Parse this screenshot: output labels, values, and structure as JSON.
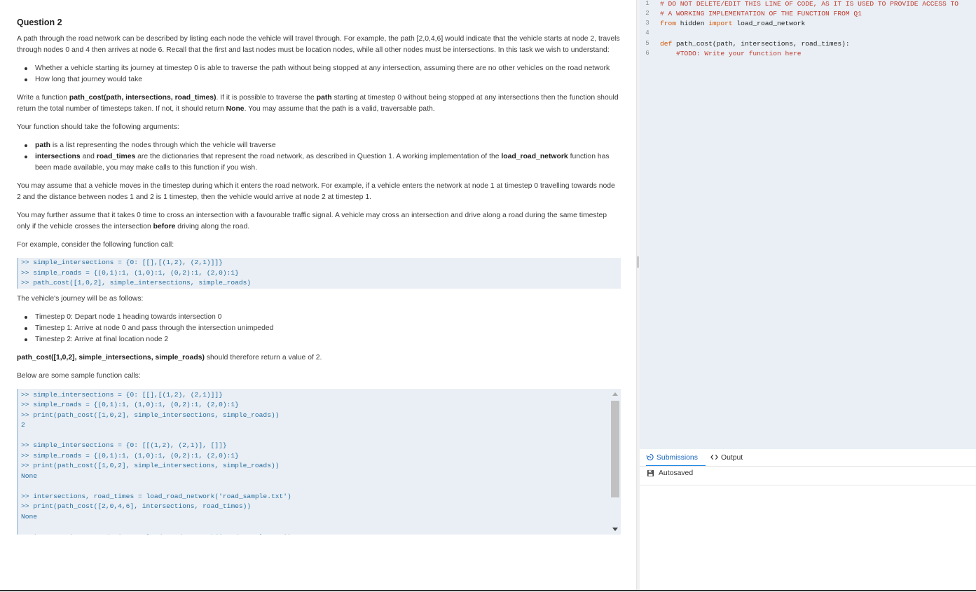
{
  "question": {
    "title": "Question 2",
    "intro": "A path through the road network can be described by listing each node the vehicle will travel through. For example, the path [2,0,4,6] would indicate that the vehicle starts at node 2, travels through nodes 0 and 4 then arrives at node 6. Recall that the first and last nodes must be location nodes, while all other nodes must be intersections. In this task we wish to understand:",
    "goals": [
      "Whether a vehicle starting its journey at timestep 0 is able to traverse the path without being stopped at any intersection, assuming there are no other vehicles on the road network",
      "How long that journey would take"
    ],
    "task_pre": "Write a function ",
    "task_fn": "path_cost(path, intersections, road_times)",
    "task_mid1": ". If it is possible to traverse the ",
    "task_path": "path",
    "task_mid2": " starting at timestep 0 without being stopped at any intersections then the function should return the total number of timesteps taken. If not, it should return ",
    "task_none": "None",
    "task_post": ". You may assume that the path is a valid, traversable path.",
    "args_intro": "Your function should take the following arguments:",
    "arg1_name": "path",
    "arg1_text": " is a list representing the nodes through which the vehicle will traverse",
    "arg2_name1": "intersections",
    "arg2_and": " and ",
    "arg2_name2": "road_times",
    "arg2_text": " are the dictionaries that represent the road network, as described in Question 1. A working implementation of the ",
    "arg2_fn": "load_road_network",
    "arg2_post": " function has been made available, you may make calls to this function if you wish.",
    "assume1": "You may assume that a vehicle moves in the timestep during which it enters the road network. For example, if a vehicle enters the network at node 1 at timestep 0 travelling towards node 2 and the distance between nodes 1 and 2 is 1 timestep, then the vehicle would arrive at node 2 at timestep 1.",
    "assume2_pre": "You may further assume that it takes 0 time to cross an intersection with a favourable traffic signal. A vehicle may cross an intersection and drive along a road during the same timestep only if the vehicle crosses the intersection ",
    "assume2_bold": "before",
    "assume2_post": " driving along the road.",
    "example_intro": "For example, consider the following function call:",
    "example_code": ">> simple_intersections = {0: [[],[(1,2), (2,1)]]}\n>> simple_roads = {(0,1):1, (1,0):1, (0,2):1, (2,0):1}\n>> path_cost([1,0,2], simple_intersections, simple_roads)",
    "journey_intro": "The vehicle's journey will be as follows:",
    "journey_steps": [
      "Timestep 0: Depart node 1 heading towards intersection 0",
      "Timestep 1: Arrive at node 0 and pass through the intersection unimpeded",
      "Timestep 2: Arrive at final location node 2"
    ],
    "result_bold": "path_cost([1,0,2], simple_intersections, simple_roads)",
    "result_post": " should therefore return a value of 2.",
    "samples_intro": "Below are some sample function calls:",
    "samples_code": ">> simple_intersections = {0: [[],[(1,2), (2,1)]]}\n>> simple_roads = {(0,1):1, (1,0):1, (0,2):1, (2,0):1}\n>> print(path_cost([1,0,2], simple_intersections, simple_roads))\n2\n\n>> simple_intersections = {0: [[(1,2), (2,1)], []]}\n>> simple_roads = {(0,1):1, (1,0):1, (0,2):1, (2,0):1}\n>> print(path_cost([1,0,2], simple_intersections, simple_roads))\nNone\n\n>> intersections, road_times = load_road_network('road_sample.txt')\n>> print(path_cost([2,0,4,6], intersections, road_times))\nNone\n\n>> intersections, road_times = load_road_network('road_sample.txt')"
  },
  "editor": {
    "line_numbers": [
      "1",
      "2",
      "3",
      "4",
      "5",
      "6"
    ],
    "line1": "# DO NOT DELETE/EDIT THIS LINE OF CODE, AS IT IS USED TO PROVIDE ACCESS TO",
    "line2": "# A WORKING IMPLEMENTATION OF THE FUNCTION FROM Q1",
    "line3_from": "from",
    "line3_mod": " hidden ",
    "line3_import": "import",
    "line3_name": " load_road_network",
    "line5_def": "def",
    "line5_rest": " path_cost(path, intersections, road_times):",
    "line6": "    #TODO: Write your function here"
  },
  "panel": {
    "tab_submissions": "Submissions",
    "tab_output": "Output",
    "autosave": "Autosaved"
  },
  "icons": [
    "history-icon",
    "code-icon",
    "save-icon"
  ]
}
